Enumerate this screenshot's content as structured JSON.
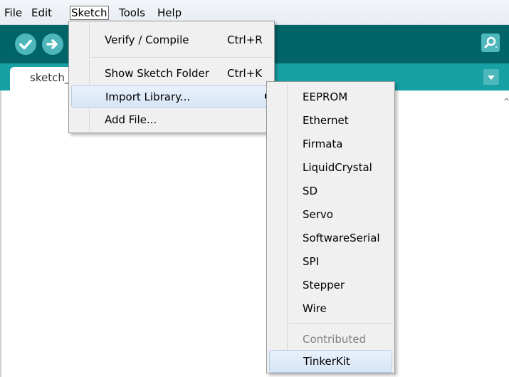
{
  "menubar": {
    "items": [
      {
        "label": "File"
      },
      {
        "label": "Edit"
      },
      {
        "label": "Sketch"
      },
      {
        "label": "Tools"
      },
      {
        "label": "Help"
      }
    ]
  },
  "toolbar": {
    "buttons": [
      {
        "icon": "check-icon"
      },
      {
        "icon": "arrow-right-icon"
      }
    ],
    "serial_icon": "magnifier-icon"
  },
  "tabs": [
    {
      "label": "sketch_"
    }
  ],
  "sketch_menu": {
    "items": [
      {
        "label": "Verify / Compile",
        "shortcut": "Ctrl+R"
      },
      {
        "label": "Show Sketch Folder",
        "shortcut": "Ctrl+K"
      },
      {
        "label": "Import Library...",
        "shortcut": "",
        "submenu": true,
        "highlighted": true
      },
      {
        "label": "Add File...",
        "shortcut": ""
      }
    ]
  },
  "import_library_submenu": {
    "items": [
      {
        "label": "EEPROM"
      },
      {
        "label": "Ethernet"
      },
      {
        "label": "Firmata"
      },
      {
        "label": "LiquidCrystal"
      },
      {
        "label": "SD"
      },
      {
        "label": "Servo"
      },
      {
        "label": "SoftwareSerial"
      },
      {
        "label": "SPI"
      },
      {
        "label": "Stepper"
      },
      {
        "label": "Wire"
      }
    ],
    "section_header": "Contributed",
    "contributed": [
      {
        "label": "TinkerKit",
        "highlighted": true
      }
    ]
  },
  "colors": {
    "toolbar": "#006468",
    "tabbar": "#17a1a5",
    "button": "#4db7bb",
    "menu_bg": "#f0f0f0",
    "highlight": "#d7e5f6"
  }
}
